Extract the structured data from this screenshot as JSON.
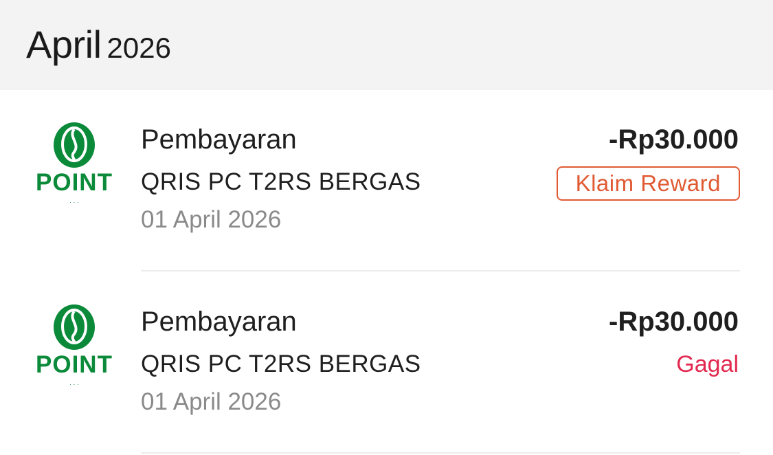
{
  "header": {
    "month": "April",
    "year": "2026"
  },
  "transactions": [
    {
      "title": "Pembayaran",
      "merchant": "QRIS PC T2RS BERGAS",
      "date": "01 April 2026",
      "amount": "-Rp30.000",
      "action_label": "Klaim Reward",
      "merchant_logo_text": "POINT",
      "logo_icon": "coffee-bean-icon"
    },
    {
      "title": "Pembayaran",
      "merchant": "QRIS PC T2RS BERGAS",
      "date": "01 April 2026",
      "amount": "-Rp30.000",
      "status": "Gagal",
      "merchant_logo_text": "POINT",
      "logo_icon": "coffee-bean-icon"
    }
  ],
  "colors": {
    "header_bg": "#f3f3f3",
    "brand_green": "#0b8a3a",
    "reward_orange": "#e05a33",
    "failed_red": "#e2294f",
    "muted_text": "#8a8a8a"
  }
}
